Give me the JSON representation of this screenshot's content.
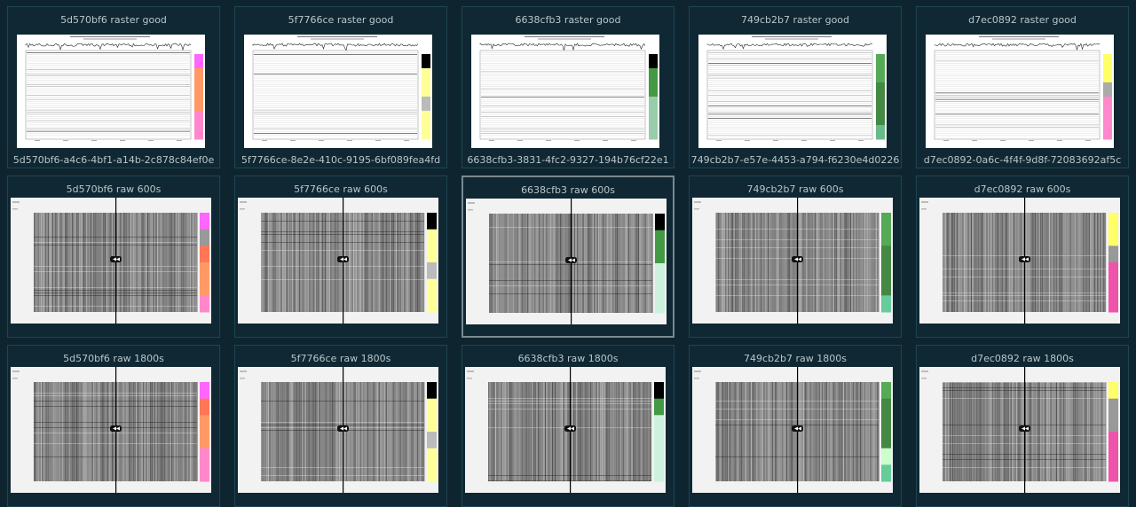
{
  "cards": [
    {
      "title": "5d570bf6 raster good",
      "caption": "5d570bf6-a4c6-4bf1-a14b-2c878c84ef0e",
      "kind": "raster",
      "legend": [
        "#ff66ff",
        "#ff9966",
        "#ff9966",
        "#ff9966",
        "#ff88cc",
        "#ff88cc"
      ],
      "selected": false
    },
    {
      "title": "5f7766ce raster good",
      "caption": "5f7766ce-8e2e-410c-9195-6bf089fea4fd",
      "kind": "raster",
      "legend": [
        "#000000",
        "#ffff99",
        "#ffff99",
        "#bbbbbb",
        "#ffff99",
        "#ffff99"
      ],
      "selected": false
    },
    {
      "title": "6638cfb3 raster good",
      "caption": "6638cfb3-3831-4fc2-9327-194b76cf22e1",
      "kind": "raster",
      "legend": [
        "#000000",
        "#449944",
        "#449944",
        "#99ccaa",
        "#99ccaa",
        "#99ccaa"
      ],
      "selected": false
    },
    {
      "title": "749cb2b7 raster good",
      "caption": "749cb2b7-e57e-4453-a794-f6230e4d0226",
      "kind": "raster",
      "legend": [
        "#55aa55",
        "#55aa55",
        "#448844",
        "#448844",
        "#448844",
        "#66bb88"
      ],
      "selected": false
    },
    {
      "title": "d7ec0892 raster good",
      "caption": "d7ec0892-0a6c-4f4f-9d8f-72083692af5c",
      "kind": "raster",
      "legend": [
        "#ffff66",
        "#ffff66",
        "#aaaaaa",
        "#ff88cc",
        "#ff88cc",
        "#ff88cc"
      ],
      "selected": false
    },
    {
      "title": "5d570bf6 raw 600s",
      "caption": "",
      "kind": "raw",
      "legend": [
        "#ff66ff",
        "#999999",
        "#ff7755",
        "#ff9966",
        "#ff9966",
        "#ff88cc"
      ],
      "selected": false
    },
    {
      "title": "5f7766ce raw 600s",
      "caption": "",
      "kind": "raw",
      "legend": [
        "#000000",
        "#ffff99",
        "#ffff99",
        "#bbbbbb",
        "#ffff99",
        "#ffff99"
      ],
      "selected": false
    },
    {
      "title": "6638cfb3 raw 600s",
      "caption": "",
      "kind": "raw",
      "legend": [
        "#000000",
        "#449944",
        "#449944",
        "#ccf2dd",
        "#ccf2dd",
        "#ccf2dd"
      ],
      "selected": true
    },
    {
      "title": "749cb2b7 raw 600s",
      "caption": "",
      "kind": "raw",
      "legend": [
        "#55aa55",
        "#55aa55",
        "#448844",
        "#448844",
        "#448844",
        "#66cc99"
      ],
      "selected": false
    },
    {
      "title": "d7ec0892 raw 600s",
      "caption": "",
      "kind": "raw",
      "legend": [
        "#ffff66",
        "#ffff66",
        "#999999",
        "#ee55aa",
        "#ee55aa",
        "#ee55aa"
      ],
      "selected": false
    },
    {
      "title": "5d570bf6 raw 1800s",
      "caption": "",
      "kind": "raw",
      "legend": [
        "#ff66ff",
        "#ff7755",
        "#ff9966",
        "#ff9966",
        "#ff88cc",
        "#ff88cc"
      ],
      "selected": false
    },
    {
      "title": "5f7766ce raw 1800s",
      "caption": "",
      "kind": "raw",
      "legend": [
        "#000000",
        "#ffff99",
        "#ffff99",
        "#bbbbbb",
        "#ffff99",
        "#ffff99"
      ],
      "selected": false
    },
    {
      "title": "6638cfb3 raw 1800s",
      "caption": "",
      "kind": "raw",
      "legend": [
        "#000000",
        "#449944",
        "#ccf2dd",
        "#ccf2dd",
        "#ccf2dd",
        "#ccf2dd"
      ],
      "selected": false
    },
    {
      "title": "749cb2b7 raw 1800s",
      "caption": "",
      "kind": "raw",
      "legend": [
        "#55aa55",
        "#448844",
        "#448844",
        "#448844",
        "#ccffcc",
        "#66cc99"
      ],
      "selected": false
    },
    {
      "title": "d7ec0892 raw 1800s",
      "caption": "",
      "kind": "raw",
      "legend": [
        "#ffff66",
        "#999999",
        "#999999",
        "#ee55aa",
        "#ee55aa",
        "#ee55aa"
      ],
      "selected": false
    }
  ]
}
